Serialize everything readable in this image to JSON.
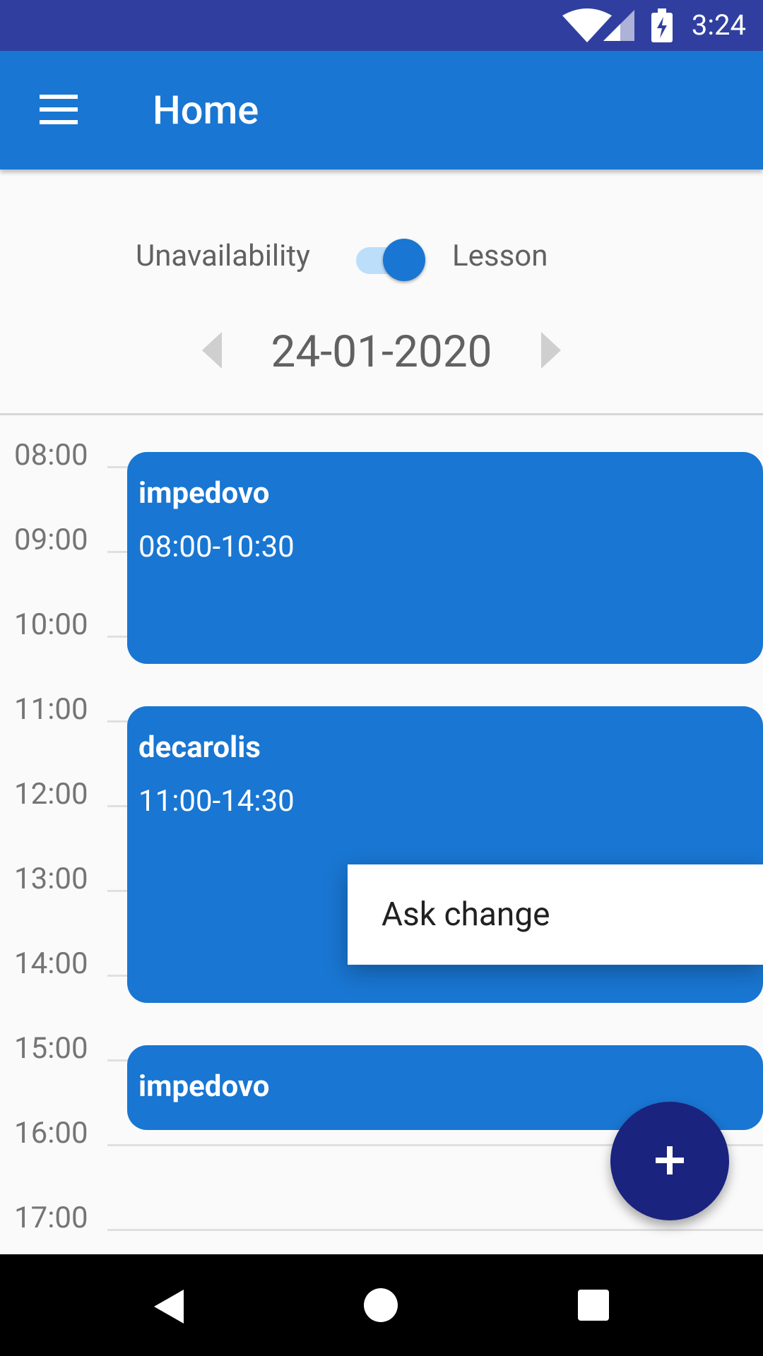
{
  "status": {
    "time": "3:24"
  },
  "appbar": {
    "title": "Home"
  },
  "toggle": {
    "left_label": "Unavailability",
    "right_label": "Lesson",
    "selected": "Lesson"
  },
  "date": {
    "value": "24-01-2020"
  },
  "hours": [
    "08:00",
    "09:00",
    "10:00",
    "11:00",
    "12:00",
    "13:00",
    "14:00",
    "15:00",
    "16:00",
    "17:00"
  ],
  "events": [
    {
      "name": "impedovo",
      "range": "08:00-10:30"
    },
    {
      "name": "decarolis",
      "range": "11:00-14:30"
    },
    {
      "name": "impedovo"
    }
  ],
  "context_menu": {
    "item": "Ask change"
  },
  "fab": {
    "icon": "add-icon"
  },
  "colors": {
    "primary": "#1976d2",
    "primary_dark": "#303f9f",
    "fab": "#1a237e"
  }
}
